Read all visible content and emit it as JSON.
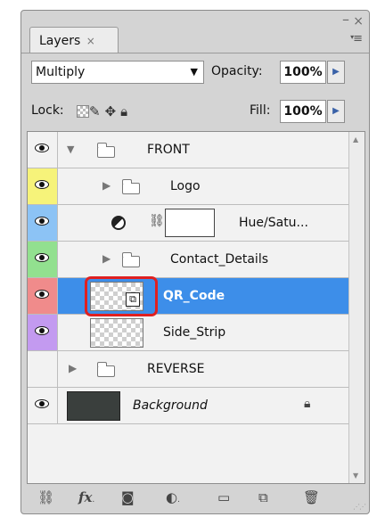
{
  "panel": {
    "tab_label": "Layers",
    "tab_close": "×",
    "window_min": "–",
    "window_close": "×",
    "menu_glyph": "▾≡"
  },
  "controls": {
    "blend_mode": "Multiply",
    "opacity_label": "Opacity:",
    "opacity_value": "100%",
    "lock_label": "Lock:",
    "fill_label": "Fill:",
    "fill_value": "100%"
  },
  "layers": [
    {
      "name": "FRONT",
      "type": "group",
      "expanded": true,
      "label_color": "none",
      "visible": true
    },
    {
      "name": "Logo",
      "type": "group",
      "expanded": false,
      "label_color": "#f6f37a",
      "visible": true
    },
    {
      "name": "Hue/Satu...",
      "type": "adjustment",
      "label_color": "#8cc3f5",
      "visible": true
    },
    {
      "name": "Contact_Details",
      "type": "group",
      "expanded": false,
      "label_color": "#92e08f",
      "visible": true
    },
    {
      "name": "QR_Code",
      "type": "smart-object",
      "selected": true,
      "label_color": "#f08b8b",
      "visible": true
    },
    {
      "name": "Side_Strip",
      "type": "pixel",
      "label_color": "#c39af0",
      "visible": true
    },
    {
      "name": "REVERSE",
      "type": "group",
      "expanded": false,
      "label_color": "none",
      "visible": false
    },
    {
      "name": "Background",
      "type": "background",
      "locked": true,
      "label_color": "none",
      "visible": true
    }
  ],
  "colors": {
    "selection": "#3d8ee9",
    "highlight_ring": "#e02020"
  },
  "bottom_icons": [
    "link-icon",
    "fx-icon",
    "mask-icon",
    "adjustment-icon",
    "new-group-icon",
    "new-layer-icon",
    "trash-icon"
  ]
}
